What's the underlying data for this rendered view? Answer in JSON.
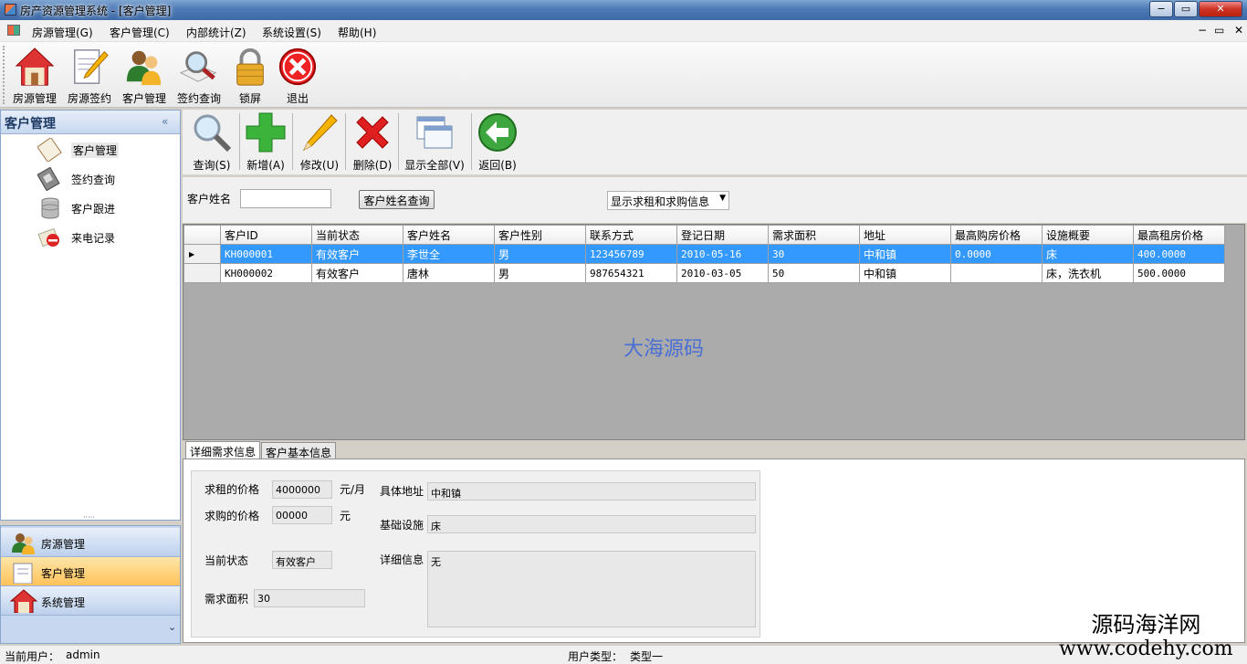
{
  "window": {
    "title": "房产资源管理系统 - [客户管理]",
    "min_label": "−",
    "max_label": "▭",
    "close_label": "✕"
  },
  "menu": [
    "房源管理(G)",
    "客户管理(C)",
    "内部统计(Z)",
    "系统设置(S)",
    "帮助(H)"
  ],
  "mdi_buttons": [
    "−",
    "▭",
    "✕"
  ],
  "main_toolbar": [
    "房源管理",
    "房源签约",
    "客户管理",
    "签约查询",
    "锁屏",
    "退出"
  ],
  "left_panel": {
    "title": "客户管理",
    "collapse": "«",
    "items": [
      "客户管理",
      "签约查询",
      "客户跟进",
      "来电记录"
    ],
    "nav": [
      "房源管理",
      "客户管理",
      "系统管理"
    ],
    "expand": "⌄",
    "grip": "·····"
  },
  "action_toolbar": [
    "查询(S)",
    "新增(A)",
    "修改(U)",
    "删除(D)",
    "显示全部(V)",
    "返回(B)"
  ],
  "search": {
    "label": "客户姓名",
    "value": "",
    "button": "客户姓名查询",
    "filter": "显示求租和求购信息"
  },
  "grid": {
    "columns": [
      "客户ID",
      "当前状态",
      "客户姓名",
      "客户性别",
      "联系方式",
      "登记日期",
      "需求面积",
      "地址",
      "最高购房价格",
      "设施概要",
      "最高租房价格"
    ],
    "rows": [
      [
        "KH000001",
        "有效客户",
        "李世全",
        "男",
        "123456789",
        "2010-05-16",
        "30",
        "中和镇",
        "0.0000",
        "床",
        "400.0000"
      ],
      [
        "KH000002",
        "有效客户",
        "唐林",
        "男",
        "987654321",
        "2010-03-05",
        "50",
        "中和镇",
        "",
        "床，洗衣机",
        "500.0000"
      ]
    ],
    "selected_row_marker": "▶"
  },
  "watermark": "大海源码",
  "tabs": [
    "详细需求信息",
    "客户基本信息"
  ],
  "detail": {
    "rent_price_label": "求租的价格",
    "rent_price": "4000000",
    "rent_unit": "元/月",
    "buy_price_label": "求购的价格",
    "buy_price": "00000",
    "buy_unit": "元",
    "status_label": "当前状态",
    "status": "有效客户",
    "area_label": "需求面积",
    "area": "30",
    "address_label": "具体地址",
    "address": "中和镇",
    "facility_label": "基础设施",
    "facility": "床",
    "info_label": "详细信息",
    "info": "无"
  },
  "statusbar": {
    "user_label": "当前用户：",
    "user": "admin",
    "type_label": "用户类型：",
    "type": "类型一"
  },
  "corner_watermark": {
    "line1": "源码海洋网",
    "line2": "www.codehy.com"
  }
}
